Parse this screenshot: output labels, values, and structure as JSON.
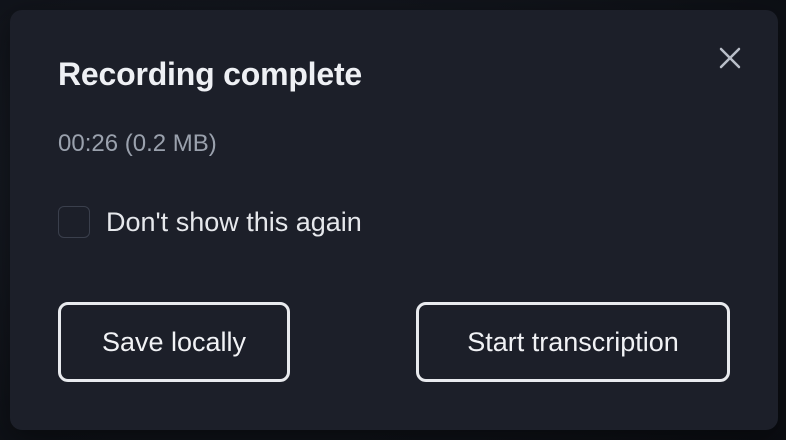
{
  "dialog": {
    "title": "Recording complete",
    "duration": "00:26",
    "size": "(0.2 MB)",
    "meta_text": "00:26 (0.2 MB)",
    "close_icon": "close-icon",
    "checkbox": {
      "label": "Don't show this again",
      "checked": false
    },
    "buttons": {
      "save_label": "Save locally",
      "transcribe_label": "Start transcription"
    }
  },
  "colors": {
    "page_background": "#11141b",
    "dialog_background": "#1c1f29",
    "title_text": "#eef0f4",
    "meta_text": "#9aa1ad",
    "button_border": "#e8eaee",
    "checkbox_border": "#3a3f4c"
  }
}
